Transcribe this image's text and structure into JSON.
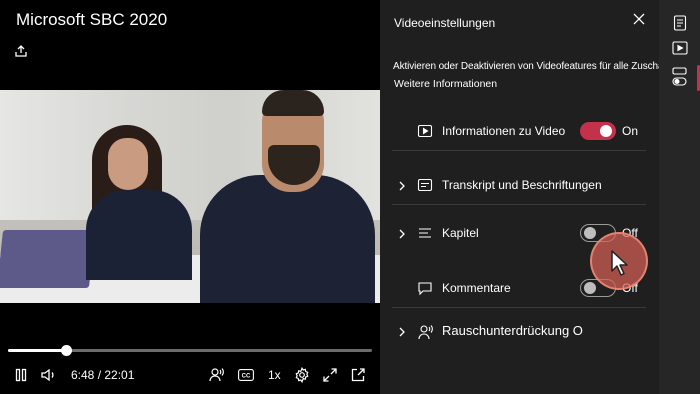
{
  "player": {
    "title": "Microsoft SBC 2020",
    "time": "6:48 / 22:01",
    "speed": "1x",
    "progress_percent": 15.8
  },
  "settings": {
    "title": "Videoeinstellungen",
    "description": "Aktivieren oder Deaktivieren von Videofeatures für alle Zuschauer",
    "more_info": "Weitere Informationen",
    "rows": [
      {
        "label": "Informationen zu Video",
        "icon": "video-info-icon",
        "toggle": "on",
        "state": "On",
        "expandable": false
      },
      {
        "label": "Transkript und Beschriftungen",
        "icon": "transcript-icon",
        "expandable": true
      },
      {
        "label": "Kapitel",
        "icon": "chapters-icon",
        "toggle": "off",
        "state": "Off",
        "expandable": true
      },
      {
        "label": "Kommentare",
        "icon": "comment-icon",
        "toggle": "off",
        "state": "Off",
        "expandable": false
      },
      {
        "label": "Rauschunterdrückung O",
        "icon": "noise-suppression-icon",
        "expandable": true
      }
    ]
  },
  "colors": {
    "accent": "#c4314b",
    "panel_bg": "#1f1f1f",
    "rail_bg": "#262626"
  }
}
